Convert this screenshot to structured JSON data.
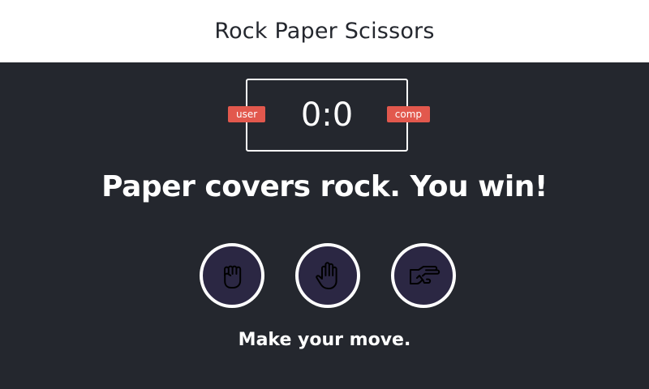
{
  "header": {
    "title": "Rock Paper Scissors"
  },
  "scoreboard": {
    "user_label": "user",
    "comp_label": "comp",
    "score": "0:0"
  },
  "result": {
    "message": "Paper covers rock. You win!"
  },
  "choices": [
    {
      "name": "rock",
      "icon": "fist-icon"
    },
    {
      "name": "paper",
      "icon": "open-hand-icon"
    },
    {
      "name": "scissors",
      "icon": "scissors-hand-icon"
    }
  ],
  "prompt": {
    "text": "Make your move."
  },
  "colors": {
    "background": "#24272e",
    "header_background": "#ffffff",
    "badge": "#e2584d",
    "choice_fill": "#2b2743",
    "foreground": "#ffffff"
  }
}
